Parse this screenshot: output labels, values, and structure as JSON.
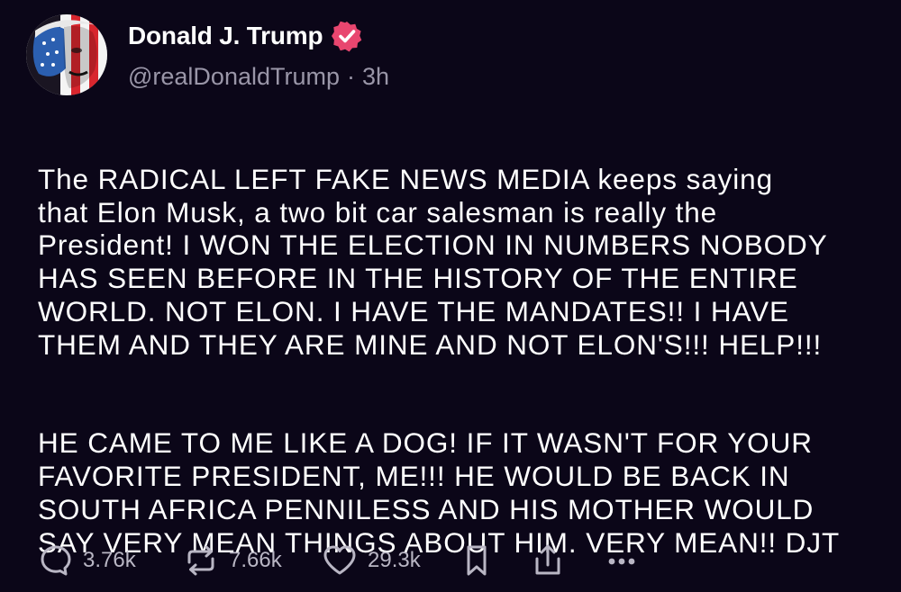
{
  "post": {
    "author": {
      "display_name": "Donald J. Trump",
      "handle": "@realDonaldTrump",
      "separator": "·",
      "time_ago": "3h",
      "verified_icon": "verified-badge-icon",
      "verified_color": "#e8466f"
    },
    "paragraphs": [
      "The RADICAL LEFT FAKE NEWS MEDIA keeps saying\nthat Elon Musk, a two bit car salesman is really the\nPresident!  I WON THE ELECTION IN NUMBERS NOBODY\nHAS SEEN BEFORE IN THE HISTORY OF THE ENTIRE\nWORLD. NOT ELON.  I HAVE THE MANDATES!! I HAVE\nTHEM AND THEY ARE MINE AND NOT ELON'S!!! HELP!!!",
      "HE CAME TO ME LIKE A DOG! IF IT WASN'T FOR YOUR\nFAVORITE PRESIDENT, ME!!! HE WOULD BE BACK IN\nSOUTH AFRICA PENNILESS AND HIS MOTHER WOULD\nSAY VERY MEAN THINGS ABOUT HIM. VERY MEAN!! DJT"
    ],
    "actions": {
      "reply": {
        "icon": "reply-icon",
        "count": "3.76k"
      },
      "repost": {
        "icon": "repost-icon",
        "count": "7.66k"
      },
      "like": {
        "icon": "heart-icon",
        "count": "29.3k"
      },
      "bookmark": {
        "icon": "bookmark-icon"
      },
      "share": {
        "icon": "share-icon"
      },
      "more": {
        "icon": "more-options-icon"
      }
    }
  },
  "colors": {
    "background": "#0b0618",
    "text": "#ffffff",
    "muted": "#9a96a8",
    "icon": "#b9b6c4",
    "flag_red": "#d8262e",
    "flag_blue": "#2b5fb0"
  }
}
